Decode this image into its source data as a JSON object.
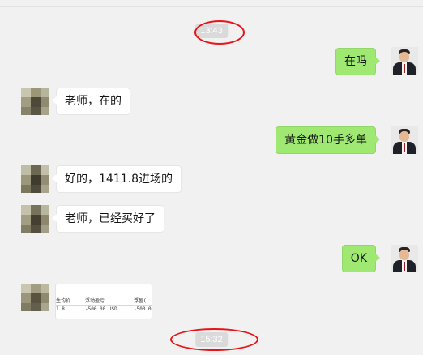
{
  "timestamps": [
    "13:43",
    "15:32"
  ],
  "messages": [
    {
      "side": "right",
      "text": "在吗"
    },
    {
      "side": "left",
      "text": "老师，在的"
    },
    {
      "side": "right",
      "text": "黄金做10手多单"
    },
    {
      "side": "left",
      "text": "好的，1411.8进场的"
    },
    {
      "side": "left",
      "text": "老师，已经买好了"
    },
    {
      "side": "right",
      "text": "OK"
    }
  ],
  "image_message": {
    "side": "left",
    "headers": [
      "生均价",
      "浮动盈亏",
      "浮盈("
    ],
    "values": [
      "1.8",
      "-500.00 USD",
      "-500.0"
    ]
  },
  "colors": {
    "background": "#f1f1f1",
    "bubble_self": "#9fe871",
    "bubble_other": "#ffffff",
    "annotation_ring": "#e8141a",
    "timestamp_bg": "#dadada"
  },
  "icons": {
    "self_avatar": "person-suit-avatar",
    "other_avatar": "pixelated-avatar"
  }
}
